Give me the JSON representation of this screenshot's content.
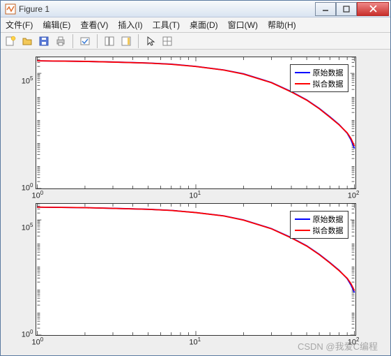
{
  "window": {
    "title": "Figure 1"
  },
  "menu": {
    "file": "文件(F)",
    "edit": "编辑(E)",
    "view": "查看(V)",
    "insert": "插入(I)",
    "tools": "工具(T)",
    "desktop": "桌面(D)",
    "window": "窗口(W)",
    "help": "帮助(H)"
  },
  "legend": {
    "raw": "原始数据",
    "fit": "拟合数据"
  },
  "colors": {
    "raw": "#0000ff",
    "fit": "#ff0000"
  },
  "watermark": "CSDN @我爱C编程",
  "axes": {
    "x_ticks": [
      "10⁰",
      "10¹",
      "10²"
    ],
    "y_ticks": [
      "10⁰",
      "10⁵"
    ]
  },
  "chart_data": [
    {
      "type": "line",
      "title": "",
      "xlabel": "",
      "ylabel": "",
      "x_scale": "log",
      "y_scale": "log",
      "xlim": [
        1,
        100
      ],
      "ylim": [
        1,
        500000
      ],
      "series": [
        {
          "name": "原始数据",
          "color": "#0000ff",
          "x": [
            1,
            2,
            3,
            5,
            7,
            10,
            15,
            20,
            30,
            40,
            50,
            60,
            70,
            80,
            90,
            95,
            100
          ],
          "y": [
            350000,
            330000,
            310000,
            280000,
            250000,
            200000,
            140000,
            95000,
            40000,
            16000,
            7000,
            3000,
            1300,
            600,
            250,
            130,
            55
          ]
        },
        {
          "name": "拟合数据",
          "color": "#ff0000",
          "x": [
            1,
            2,
            3,
            5,
            7,
            10,
            15,
            20,
            30,
            40,
            50,
            60,
            70,
            80,
            90,
            95,
            100
          ],
          "y": [
            350000,
            330000,
            308000,
            278000,
            248000,
            198000,
            138000,
            93000,
            39000,
            15500,
            6800,
            2900,
            1250,
            580,
            260,
            150,
            70
          ]
        }
      ]
    },
    {
      "type": "line",
      "title": "",
      "xlabel": "",
      "ylabel": "",
      "x_scale": "log",
      "y_scale": "log",
      "xlim": [
        1,
        100
      ],
      "ylim": [
        1,
        500000
      ],
      "series": [
        {
          "name": "原始数据",
          "color": "#0000ff",
          "x": [
            1,
            2,
            3,
            5,
            7,
            10,
            15,
            20,
            30,
            40,
            50,
            60,
            70,
            80,
            90,
            95,
            100
          ],
          "y": [
            360000,
            340000,
            320000,
            290000,
            260000,
            210000,
            150000,
            100000,
            42000,
            17000,
            7500,
            3200,
            1400,
            650,
            280,
            150,
            70
          ]
        },
        {
          "name": "拟合数据",
          "color": "#ff0000",
          "x": [
            1,
            2,
            3,
            5,
            7,
            10,
            15,
            20,
            30,
            40,
            50,
            60,
            70,
            80,
            90,
            95,
            100
          ],
          "y": [
            360000,
            340000,
            318000,
            288000,
            258000,
            208000,
            148000,
            98000,
            41000,
            16500,
            7300,
            3100,
            1350,
            630,
            290,
            170,
            85
          ]
        }
      ]
    }
  ]
}
